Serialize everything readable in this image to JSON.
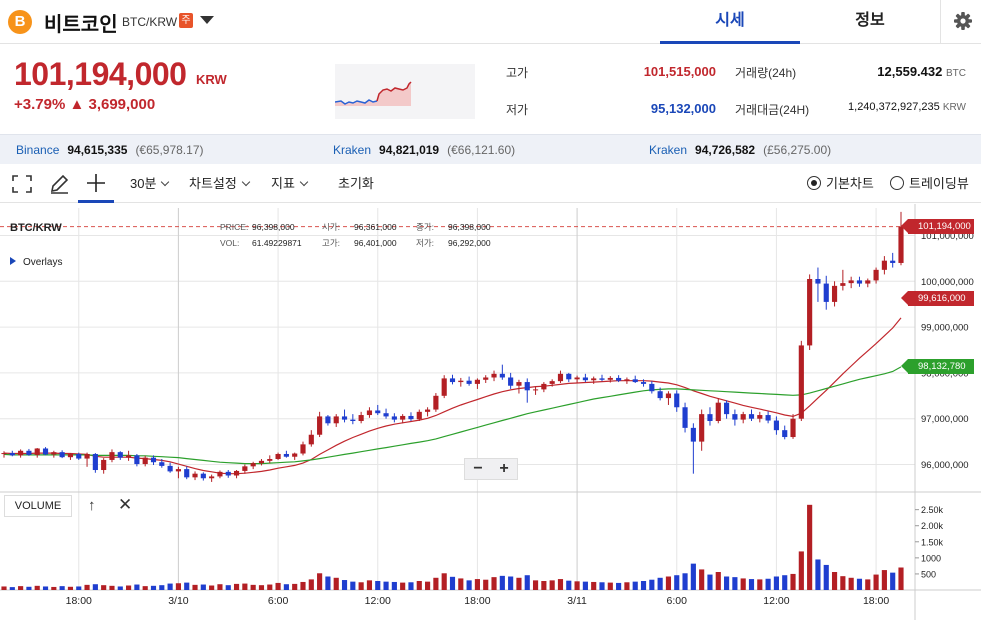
{
  "header": {
    "coin_logo": "B",
    "coin_name": "비트코인",
    "pair": "BTC/KRW",
    "badge": "주",
    "tab_quote": "시세",
    "tab_info": "정보",
    "settings_icon": "gear-icon"
  },
  "price": {
    "current": "101,194,000",
    "unit": "KRW",
    "change_pct": "+3.79%",
    "change_amt": "▲ 3,699,000"
  },
  "stats": {
    "high_label": "고가",
    "high_value": "101,515,000",
    "low_label": "저가",
    "low_value": "95,132,000",
    "volume_label": "거래량(24h)",
    "volume_value": "12,559.432",
    "volume_unit": "BTC",
    "turnover_label": "거래대금(24H)",
    "turnover_value": "1,240,372,927,235",
    "turnover_unit": "KRW"
  },
  "exchanges": [
    {
      "name": "Binance",
      "price": "94,615,335",
      "fx": "(€65,978.17)"
    },
    {
      "name": "Kraken",
      "price": "94,821,019",
      "fx": "(€66,121.60)"
    },
    {
      "name": "Kraken",
      "price": "94,726,582",
      "fx": "(£56,275.00)"
    }
  ],
  "toolbar": {
    "interval": "30분",
    "chart_settings": "차트설정",
    "indicators": "지표",
    "reset": "초기화",
    "basic_chart": "기본차트",
    "trading_view": "트레이딩뷰"
  },
  "tooltip": {
    "price_k": "PRICE:",
    "price_v": "96,398,000",
    "open_k": "시가:",
    "open_v": "96,361,000",
    "close_k": "종가:",
    "close_v": "96,398,000",
    "vol_k": "VOL:",
    "vol_v": "61.49229871",
    "high_k": "고가:",
    "high_v": "96,401,000",
    "low_k": "저가:",
    "low_v": "96,292,000"
  },
  "chart_labels": {
    "pair": "BTC/KRW",
    "overlays": "Overlays",
    "volume": "VOLUME",
    "zoom_out": "−",
    "zoom_in": "+",
    "vol_up": "↑",
    "vol_close": "✕"
  },
  "colors": {
    "up": "#b31f24",
    "down": "#1f3ecf",
    "ma_short": "#c1272d",
    "ma_long": "#2ca02c",
    "accent": "#1a47b8"
  },
  "chart_data": {
    "type": "candlestick",
    "ylim": [
      95400000,
      101600000
    ],
    "y_ticks": [
      "96,000,000",
      "97,000,000",
      "98,000,000",
      "99,000,000",
      "100,000,000",
      "101,000,000"
    ],
    "y_tick_values": [
      96000000,
      97000000,
      98000000,
      99000000,
      100000000,
      101000000
    ],
    "x_ticks": [
      "18:00",
      "3/10",
      "6:00",
      "12:00",
      "18:00",
      "3/11",
      "6:00",
      "12:00",
      "18:00"
    ],
    "x_tick_index": [
      9,
      21,
      33,
      45,
      57,
      69,
      81,
      93,
      105
    ],
    "price_tags": [
      {
        "label": "101,194,000",
        "value": 101194000,
        "color": "#c1272d"
      },
      {
        "label": "99,616,000",
        "value": 99616000,
        "color": "#c1272d"
      },
      {
        "label": "98,132,780",
        "value": 98132780,
        "color": "#2ca02c"
      }
    ],
    "volume_ticks": [
      "2.50k",
      "2.00k",
      "1.50k",
      "1000",
      "500"
    ],
    "volume_tick_values": [
      2500,
      2000,
      1500,
      1000,
      500
    ],
    "volume_max": 2800,
    "candles": [
      [
        96230000,
        96290000,
        96150000,
        96250000,
        110
      ],
      [
        96250000,
        96300000,
        96180000,
        96200000,
        90
      ],
      [
        96200000,
        96330000,
        96150000,
        96300000,
        120
      ],
      [
        96300000,
        96340000,
        96190000,
        96210000,
        100
      ],
      [
        96210000,
        96360000,
        96150000,
        96350000,
        130
      ],
      [
        96350000,
        96380000,
        96200000,
        96220000,
        110
      ],
      [
        96220000,
        96300000,
        96150000,
        96270000,
        95
      ],
      [
        96270000,
        96310000,
        96140000,
        96160000,
        120
      ],
      [
        96160000,
        96250000,
        96100000,
        96230000,
        100
      ],
      [
        96230000,
        96260000,
        96100000,
        96130000,
        110
      ],
      [
        96130000,
        96260000,
        95950000,
        96230000,
        160
      ],
      [
        96230000,
        96250000,
        95820000,
        95880000,
        180
      ],
      [
        95880000,
        96140000,
        95800000,
        96100000,
        150
      ],
      [
        96100000,
        96330000,
        96050000,
        96270000,
        130
      ],
      [
        96270000,
        96290000,
        96100000,
        96150000,
        110
      ],
      [
        96150000,
        96300000,
        96080000,
        96200000,
        140
      ],
      [
        96200000,
        96230000,
        95960000,
        96010000,
        170
      ],
      [
        96010000,
        96190000,
        95960000,
        96150000,
        120
      ],
      [
        96150000,
        96200000,
        95990000,
        96050000,
        130
      ],
      [
        96050000,
        96120000,
        95930000,
        95970000,
        150
      ],
      [
        95970000,
        96040000,
        95820000,
        95850000,
        200
      ],
      [
        95850000,
        95950000,
        95700000,
        95900000,
        210
      ],
      [
        95900000,
        95960000,
        95680000,
        95720000,
        230
      ],
      [
        95720000,
        95850000,
        95660000,
        95800000,
        160
      ],
      [
        95800000,
        95830000,
        95650000,
        95700000,
        170
      ],
      [
        95700000,
        95780000,
        95620000,
        95740000,
        140
      ],
      [
        95740000,
        95870000,
        95700000,
        95840000,
        180
      ],
      [
        95840000,
        95880000,
        95710000,
        95760000,
        150
      ],
      [
        95760000,
        95880000,
        95700000,
        95860000,
        190
      ],
      [
        95860000,
        96000000,
        95800000,
        95960000,
        200
      ],
      [
        95960000,
        96060000,
        95900000,
        96030000,
        160
      ],
      [
        96030000,
        96120000,
        95980000,
        96080000,
        150
      ],
      [
        96080000,
        96200000,
        96030000,
        96120000,
        170
      ],
      [
        96120000,
        96260000,
        96100000,
        96230000,
        220
      ],
      [
        96230000,
        96300000,
        96150000,
        96170000,
        180
      ],
      [
        96170000,
        96260000,
        96100000,
        96240000,
        190
      ],
      [
        96240000,
        96500000,
        96200000,
        96440000,
        250
      ],
      [
        96440000,
        96750000,
        96390000,
        96650000,
        330
      ],
      [
        96650000,
        97150000,
        96600000,
        97050000,
        520
      ],
      [
        97050000,
        97080000,
        96850000,
        96900000,
        420
      ],
      [
        96900000,
        97100000,
        96820000,
        97050000,
        380
      ],
      [
        97050000,
        97200000,
        96920000,
        96980000,
        310
      ],
      [
        96980000,
        97100000,
        96880000,
        96950000,
        260
      ],
      [
        96950000,
        97150000,
        96900000,
        97080000,
        240
      ],
      [
        97080000,
        97250000,
        97020000,
        97180000,
        300
      ],
      [
        97180000,
        97300000,
        97080000,
        97120000,
        280
      ],
      [
        97120000,
        97220000,
        97000000,
        97050000,
        260
      ],
      [
        97050000,
        97120000,
        96920000,
        96980000,
        250
      ],
      [
        96980000,
        97100000,
        96900000,
        97060000,
        230
      ],
      [
        97060000,
        97140000,
        96950000,
        96990000,
        240
      ],
      [
        96990000,
        97200000,
        96950000,
        97150000,
        280
      ],
      [
        97150000,
        97250000,
        97050000,
        97200000,
        260
      ],
      [
        97200000,
        97560000,
        97150000,
        97500000,
        380
      ],
      [
        97500000,
        97950000,
        97450000,
        97880000,
        520
      ],
      [
        97880000,
        97960000,
        97750000,
        97800000,
        410
      ],
      [
        97800000,
        97890000,
        97700000,
        97830000,
        360
      ],
      [
        97830000,
        97920000,
        97720000,
        97760000,
        300
      ],
      [
        97760000,
        97880000,
        97650000,
        97850000,
        340
      ],
      [
        97850000,
        97950000,
        97780000,
        97900000,
        320
      ],
      [
        97900000,
        98050000,
        97820000,
        97980000,
        400
      ],
      [
        97980000,
        98180000,
        97850000,
        97900000,
        440
      ],
      [
        97900000,
        98000000,
        97650000,
        97720000,
        420
      ],
      [
        97720000,
        97850000,
        97550000,
        97800000,
        380
      ],
      [
        97800000,
        97880000,
        97350000,
        97620000,
        460
      ],
      [
        97620000,
        97700000,
        97520000,
        97640000,
        300
      ],
      [
        97640000,
        97800000,
        97580000,
        97760000,
        280
      ],
      [
        97760000,
        97860000,
        97700000,
        97820000,
        300
      ],
      [
        97820000,
        98050000,
        97780000,
        97980000,
        340
      ],
      [
        97980000,
        98000000,
        97800000,
        97860000,
        290
      ],
      [
        97860000,
        97940000,
        97780000,
        97900000,
        270
      ],
      [
        97900000,
        97980000,
        97800000,
        97840000,
        260
      ],
      [
        97840000,
        97920000,
        97760000,
        97880000,
        250
      ],
      [
        97880000,
        97960000,
        97820000,
        97850000,
        240
      ],
      [
        97850000,
        97930000,
        97790000,
        97890000,
        230
      ],
      [
        97890000,
        97950000,
        97800000,
        97830000,
        220
      ],
      [
        97830000,
        97900000,
        97760000,
        97860000,
        240
      ],
      [
        97860000,
        97940000,
        97780000,
        97800000,
        260
      ],
      [
        97800000,
        97860000,
        97700000,
        97760000,
        280
      ],
      [
        97760000,
        97820000,
        97550000,
        97600000,
        320
      ],
      [
        97600000,
        97680000,
        97400000,
        97450000,
        380
      ],
      [
        97450000,
        97600000,
        97300000,
        97550000,
        420
      ],
      [
        97550000,
        97620000,
        97150000,
        97250000,
        460
      ],
      [
        97250000,
        97350000,
        96700000,
        96800000,
        520
      ],
      [
        96800000,
        96900000,
        95800000,
        96500000,
        820
      ],
      [
        96500000,
        97200000,
        96300000,
        97100000,
        640
      ],
      [
        97100000,
        97250000,
        96850000,
        96950000,
        480
      ],
      [
        96950000,
        97450000,
        96900000,
        97350000,
        560
      ],
      [
        97350000,
        97400000,
        97000000,
        97100000,
        420
      ],
      [
        97100000,
        97200000,
        96850000,
        96980000,
        400
      ],
      [
        96980000,
        97150000,
        96900000,
        97100000,
        360
      ],
      [
        97100000,
        97200000,
        96950000,
        97000000,
        340
      ],
      [
        97000000,
        97150000,
        96920000,
        97080000,
        330
      ],
      [
        97080000,
        97160000,
        96900000,
        96960000,
        350
      ],
      [
        96960000,
        97050000,
        96650000,
        96750000,
        420
      ],
      [
        96750000,
        96850000,
        96550000,
        96600000,
        460
      ],
      [
        96600000,
        97100000,
        96560000,
        97000000,
        500
      ],
      [
        97000000,
        98700000,
        96950000,
        98600000,
        1200
      ],
      [
        98600000,
        100150000,
        98500000,
        100050000,
        2650
      ],
      [
        100050000,
        100300000,
        99550000,
        99950000,
        950
      ],
      [
        99950000,
        100120000,
        99380000,
        99550000,
        780
      ],
      [
        99550000,
        100000000,
        99450000,
        99900000,
        560
      ],
      [
        99900000,
        100250000,
        99800000,
        99960000,
        430
      ],
      [
        99960000,
        100100000,
        99850000,
        100020000,
        380
      ],
      [
        100020000,
        100100000,
        99880000,
        99950000,
        350
      ],
      [
        99950000,
        100060000,
        99870000,
        100020000,
        330
      ],
      [
        100020000,
        100300000,
        99950000,
        100250000,
        480
      ],
      [
        100250000,
        100550000,
        100150000,
        100450000,
        620
      ],
      [
        100450000,
        100620000,
        100300000,
        100400000,
        540
      ],
      [
        100400000,
        101515000,
        100350000,
        101194000,
        700
      ]
    ],
    "series": [
      {
        "name": "MA short",
        "values": [
          96250000,
          96240000,
          96240000,
          96240000,
          96250000,
          96250000,
          96250000,
          96240000,
          96240000,
          96230000,
          96220000,
          96180000,
          96160000,
          96160000,
          96160000,
          96160000,
          96140000,
          96130000,
          96110000,
          96090000,
          96060000,
          96010000,
          95960000,
          95910000,
          95870000,
          95840000,
          95810000,
          95800000,
          95800000,
          95810000,
          95830000,
          95850000,
          95880000,
          95920000,
          95950000,
          95980000,
          96030000,
          96110000,
          96220000,
          96320000,
          96420000,
          96510000,
          96590000,
          96660000,
          96730000,
          96790000,
          96840000,
          96880000,
          96910000,
          96940000,
          96970000,
          97010000,
          97070000,
          97150000,
          97230000,
          97300000,
          97360000,
          97420000,
          97480000,
          97540000,
          97590000,
          97630000,
          97660000,
          97680000,
          97700000,
          97710000,
          97730000,
          97750000,
          97770000,
          97780000,
          97790000,
          97800000,
          97810000,
          97820000,
          97830000,
          97830000,
          97830000,
          97830000,
          97820000,
          97800000,
          97780000,
          97740000,
          97680000,
          97610000,
          97550000,
          97490000,
          97440000,
          97390000,
          97340000,
          97290000,
          97250000,
          97210000,
          97170000,
          97130000,
          97080000,
          97050000,
          97120000,
          97280000,
          97450000,
          97620000,
          97800000,
          97980000,
          98150000,
          98320000,
          98480000,
          98640000,
          98810000,
          98980000,
          99200000
        ]
      },
      {
        "name": "MA long",
        "values": [
          96220000,
          96210000,
          96210000,
          96210000,
          96210000,
          96210000,
          96210000,
          96210000,
          96210000,
          96210000,
          96210000,
          96200000,
          96200000,
          96200000,
          96200000,
          96200000,
          96190000,
          96190000,
          96180000,
          96170000,
          96160000,
          96150000,
          96130000,
          96110000,
          96090000,
          96070000,
          96050000,
          96040000,
          96030000,
          96020000,
          96020000,
          96020000,
          96030000,
          96040000,
          96050000,
          96060000,
          96080000,
          96100000,
          96130000,
          96160000,
          96190000,
          96220000,
          96250000,
          96280000,
          96310000,
          96340000,
          96370000,
          96400000,
          96430000,
          96460000,
          96490000,
          96520000,
          96560000,
          96610000,
          96660000,
          96710000,
          96760000,
          96810000,
          96860000,
          96910000,
          96960000,
          97010000,
          97060000,
          97110000,
          97150000,
          97190000,
          97230000,
          97270000,
          97310000,
          97350000,
          97390000,
          97430000,
          97460000,
          97490000,
          97520000,
          97550000,
          97580000,
          97610000,
          97630000,
          97640000,
          97650000,
          97650000,
          97640000,
          97630000,
          97620000,
          97610000,
          97600000,
          97590000,
          97580000,
          97570000,
          97560000,
          97550000,
          97540000,
          97530000,
          97520000,
          97510000,
          97520000,
          97560000,
          97610000,
          97660000,
          97710000,
          97760000,
          97810000,
          97860000,
          97900000,
          97940000,
          97980000,
          98030000,
          98130000
        ]
      }
    ]
  }
}
